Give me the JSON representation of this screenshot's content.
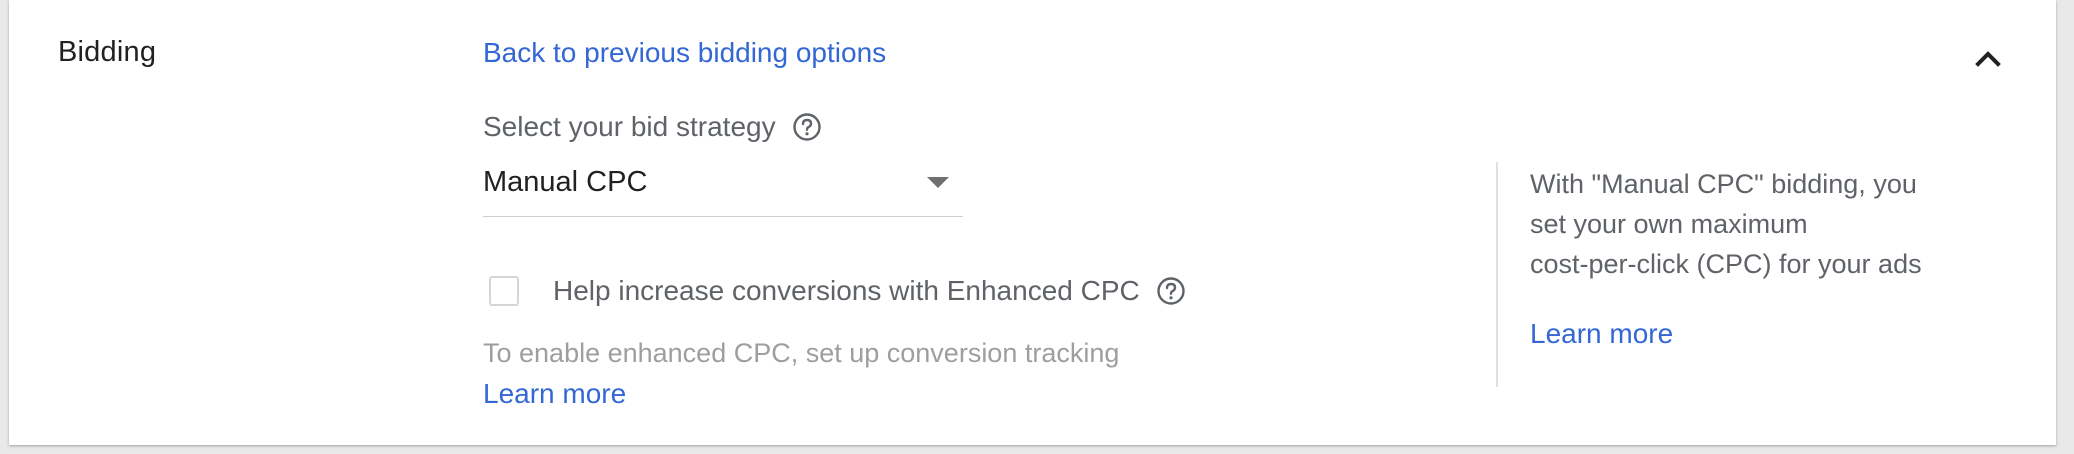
{
  "section": {
    "title": "Bidding",
    "back_link": "Back to previous bidding options"
  },
  "bid_strategy": {
    "label": "Select your bid strategy",
    "selected": "Manual CPC"
  },
  "enhanced_cpc": {
    "checkbox_label": "Help increase conversions with Enhanced CPC",
    "checked": false,
    "hint": "To enable enhanced CPC, set up conversion tracking",
    "learn_more": "Learn more"
  },
  "side_panel": {
    "lines": [
      "With \"Manual CPC\" bidding, you",
      "set your own maximum",
      "cost-per-click (CPC) for your ads"
    ],
    "learn_more": "Learn more"
  },
  "icons": {
    "collapse": "chevron-up-icon",
    "help": "help-circle-icon"
  },
  "colors": {
    "link": "#3367d6",
    "text_primary": "#212121",
    "text_secondary": "#5f6368",
    "text_disabled": "#9e9e9e"
  }
}
